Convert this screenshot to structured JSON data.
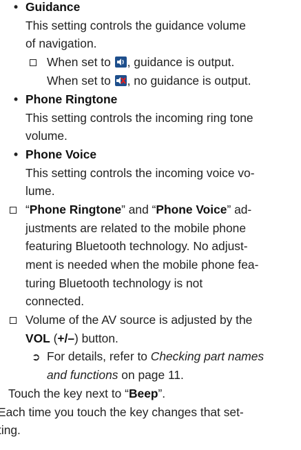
{
  "sections": {
    "guidance_title": "Guidance",
    "guidance_desc_1": "This setting controls the guidance volume",
    "guidance_desc_2": "of navigation.",
    "guidance_on_a": "When set to",
    "guidance_on_b": ", guidance is output.",
    "guidance_off_a": "When set to",
    "guidance_off_b": ", no guidance is output.",
    "ringtone_title": "Phone Ringtone",
    "ringtone_desc_1": "This setting controls the incoming ring tone",
    "ringtone_desc_2": "volume.",
    "voice_title": "Phone Voice",
    "voice_desc_1": "This setting controls the incoming voice vo-",
    "voice_desc_2": "lume."
  },
  "note1": {
    "q1": "“",
    "b1": "Phone Ringtone",
    "mid": "” and “",
    "b2": "Phone Voice",
    "end": "” ad-",
    "l2": "justments are related to the mobile phone",
    "l3": "featuring Bluetooth technology. No adjust-",
    "l4": "ment is needed when the mobile phone fea-",
    "l5": "turing Bluetooth technology is not",
    "l6": "connected."
  },
  "note2": {
    "l1": "Volume of the AV source is adjusted by the",
    "vol": "VOL",
    "paren": " (",
    "pm": "+/–",
    "close": ") button.",
    "ref_a": "For details, refer to ",
    "ref_i1": "Checking part names",
    "ref_i2": "and functions",
    "ref_b": " on page 11."
  },
  "step": {
    "a": "Touch the key next to “",
    "b": "Beep",
    "c": "”.",
    "d1": "Each time you touch the key changes that set-",
    "d2": "ting."
  },
  "icons": {
    "bullet": "•",
    "arrow": "➲"
  }
}
